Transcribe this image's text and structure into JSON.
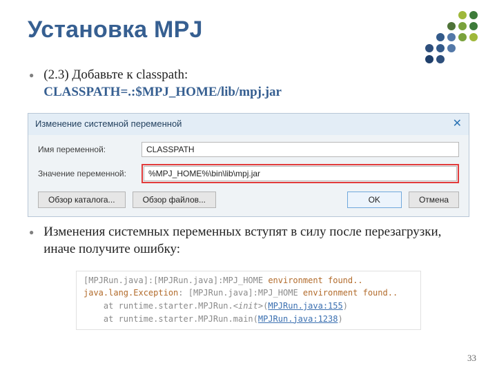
{
  "title": "Установка MPJ",
  "decoColors": [
    "transparent",
    "transparent",
    "transparent",
    "#9fb83a",
    "#3e7b3a",
    "transparent",
    "transparent",
    "#4e7338",
    "#7aa23c",
    "#3e7b3a",
    "transparent",
    "#335a8a",
    "#5378a8",
    "#7aa23c",
    "#9fb83a",
    "#2e4f7c",
    "#335a8a",
    "#5378a8",
    "transparent",
    "transparent",
    "#1f3f6b",
    "#2e4f7c",
    "transparent",
    "transparent",
    "transparent"
  ],
  "bullet1": {
    "lead": "(2.3) Добавьте к classpath:",
    "code": "CLASSPATH=.:$MPJ_HOME/lib/mpj.jar"
  },
  "dialog": {
    "title": "Изменение системной переменной",
    "label_name": "Имя переменной:",
    "val_name": "CLASSPATH",
    "label_value": "Значение переменной:",
    "val_value": "%MPJ_HOME%\\bin\\lib\\mpj.jar",
    "btn_browse_dir": "Обзор каталога...",
    "btn_browse_file": "Обзор файлов...",
    "btn_ok": "OK",
    "btn_cancel": "Отмена"
  },
  "bullet2": "Изменения системных переменных вступят в силу после перезагрузки, иначе получите ошибку:",
  "console": {
    "l1a": "[MPJRun.java]:[MPJRun.java]:MPJ_HOME ",
    "l1b": "environment found..",
    "l2a": "java.lang.Exception",
    "l2b": ": [MPJRun.java]:MPJ_HOME ",
    "l2c": "environment found..",
    "l3a": "    at runtime.starter.MPJRun.",
    "l3b": "<init>",
    "l3c": "(",
    "l3d": "MPJRun.java:155",
    "l3e": ")",
    "l4a": "    at runtime.starter.MPJRun.main(",
    "l4b": "MPJRun.java:1238",
    "l4c": ")"
  },
  "pageNumber": "33"
}
